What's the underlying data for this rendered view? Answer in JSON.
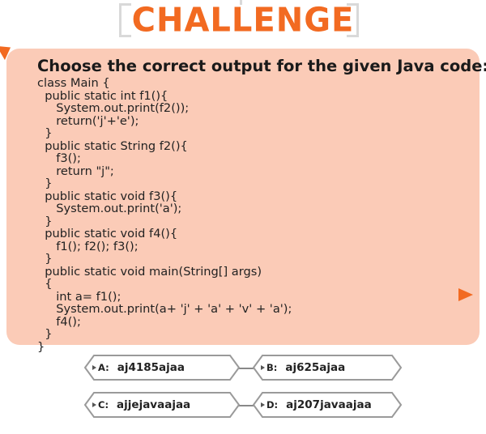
{
  "header": {
    "title": "CHALLENGE"
  },
  "question": "Choose the correct output for the given Java code:",
  "code_lines": [
    "class Main {",
    "  public static int f1(){",
    "     System.out.print(f2());",
    "     return('j'+'e');",
    "  }",
    "  public static String f2(){",
    "     f3();",
    "     return \"j\";",
    "  }",
    "  public static void f3(){",
    "     System.out.print('a');",
    "  }",
    "  public static void f4(){",
    "     f1(); f2(); f3();",
    "  }",
    "  public static void main(String[] args)",
    "  {",
    "     int a= f1();",
    "     System.out.print(a+ 'j' + 'a' + 'v' + 'a');",
    "     f4();",
    "  }",
    "}"
  ],
  "options": [
    {
      "label": "A:",
      "text": "aj4185ajaa"
    },
    {
      "label": "B:",
      "text": "aj625ajaa"
    },
    {
      "label": "C:",
      "text": "ajjejavaajaa"
    },
    {
      "label": "D:",
      "text": "aj207javaajaa"
    }
  ],
  "colors": {
    "accent": "#f26a21",
    "card": "#fbcbb7",
    "option_border": "#9a9a9a"
  }
}
